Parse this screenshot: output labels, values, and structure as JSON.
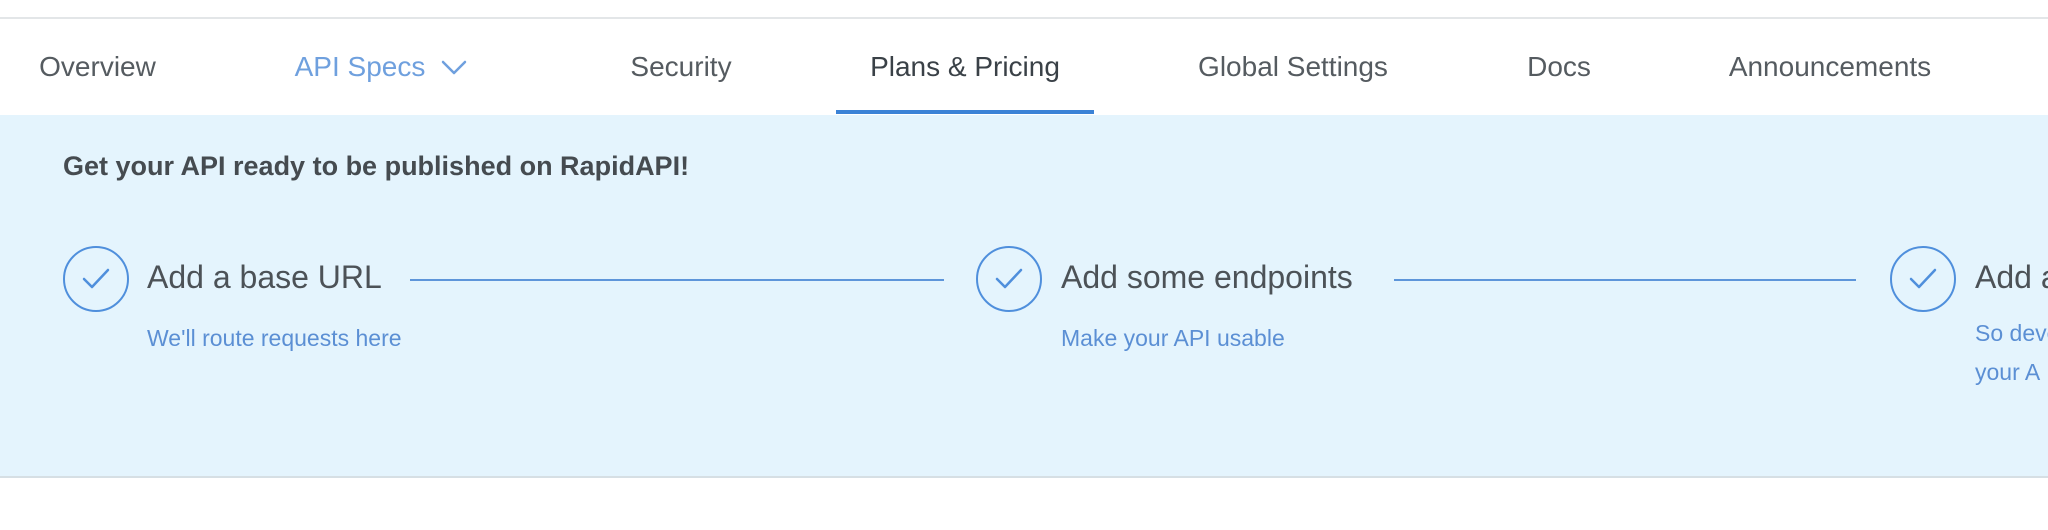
{
  "tabs": [
    {
      "label": "Overview"
    },
    {
      "label": "API Specs"
    },
    {
      "label": "Security"
    },
    {
      "label": "Plans & Pricing",
      "active": true
    },
    {
      "label": "Global Settings"
    },
    {
      "label": "Docs"
    },
    {
      "label": "Announcements"
    }
  ],
  "banner": {
    "title": "Get your API ready to be published on RapidAPI!",
    "steps": [
      {
        "title": "Add a base URL",
        "subtitle": "We'll route requests here",
        "icon": "check-icon"
      },
      {
        "title": "Add some endpoints",
        "subtitle": "Make your API usable",
        "icon": "check-icon"
      },
      {
        "title": "Add a",
        "subtitle_lines": [
          "So deve",
          "your A"
        ],
        "icon": "check-icon"
      }
    ]
  },
  "colors": {
    "accent": "#3b82d6",
    "banner_bg": "#e4f4fd",
    "api_specs_tab": "#6fa0de"
  }
}
